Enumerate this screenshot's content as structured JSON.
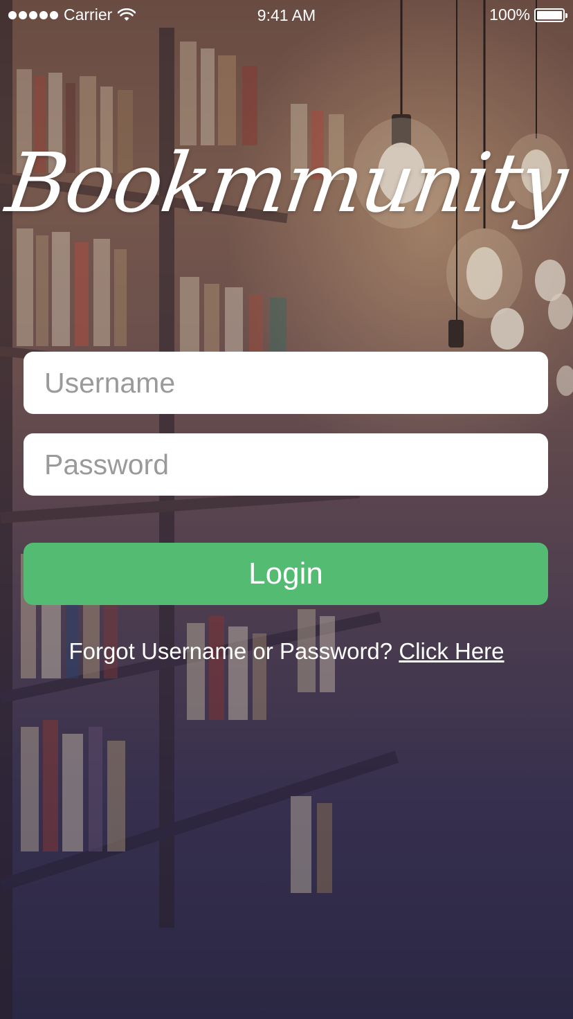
{
  "status_bar": {
    "carrier": "Carrier",
    "time": "9:41 AM",
    "battery": "100%"
  },
  "app": {
    "logo_text": "Bookmmunity"
  },
  "form": {
    "username_placeholder": "Username",
    "password_placeholder": "Password",
    "login_label": "Login",
    "forgot_text": "Forgot Username or Password?",
    "forgot_link": "Click Here"
  },
  "colors": {
    "accent": "#53bb72",
    "field_background": "#ffffff"
  }
}
